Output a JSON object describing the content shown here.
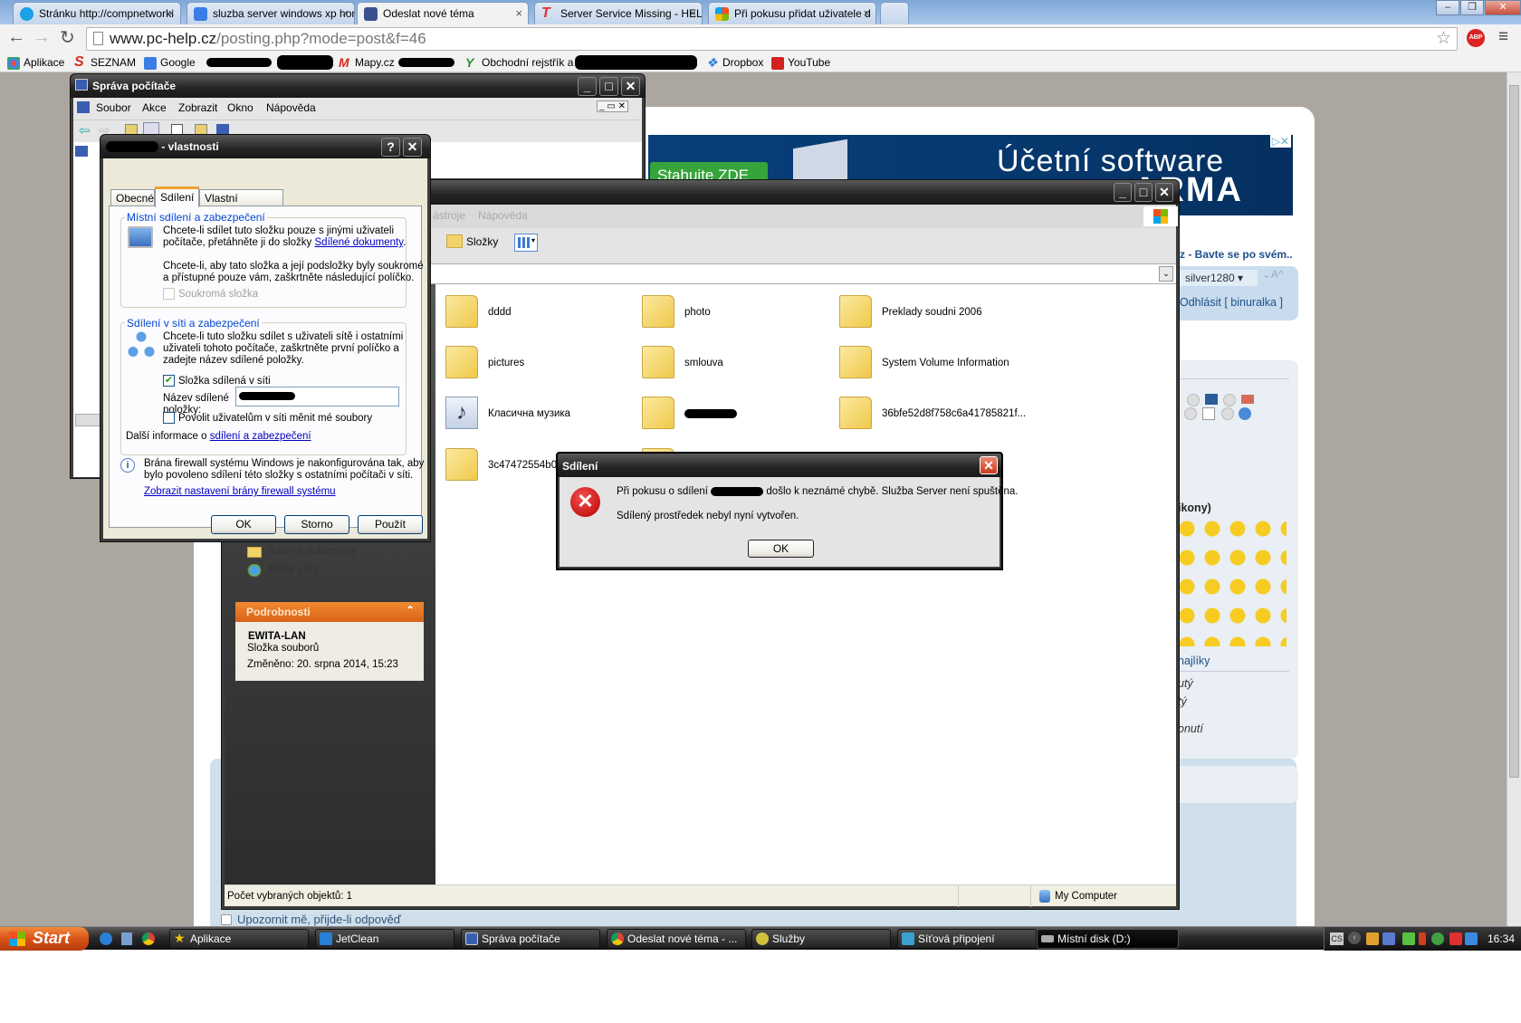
{
  "browser": {
    "tabs": [
      {
        "label": "Stránku http://compnetworki",
        "icon": "a-icon",
        "color": "#1aa1e6"
      },
      {
        "label": "sluzba server windows xp hor",
        "icon": "google-icon",
        "color": "#3b7de6"
      },
      {
        "label": "Odeslat nové téma",
        "icon": "computer-icon",
        "color": "#3a4f8f"
      },
      {
        "label": "Server Service Missing - HEL",
        "icon": "t-icon",
        "color": "#e03030"
      },
      {
        "label": "Při pokusu přidat uživatele d",
        "icon": "windows-icon",
        "color": "#f0a020"
      }
    ],
    "url_host": "www.pc-help.cz",
    "url_path": "/posting.php?mode=post&f=46",
    "bookmarks": [
      {
        "label": "Aplikace",
        "color": "#e84c3d"
      },
      {
        "label": "SEZNAM",
        "color": "#d52b1e"
      },
      {
        "label": "Google",
        "color": "#3b7de6"
      },
      {
        "label": "Mapy.cz",
        "color": "#d52b1e"
      },
      {
        "label": "Obchodní rejstřík a Sb...",
        "color": "#2e8b2e"
      },
      {
        "label": "Dropbox",
        "color": "#2b7fe0"
      },
      {
        "label": "YouTube",
        "color": "#d42020"
      }
    ],
    "abp": "ABP"
  },
  "webpage": {
    "ad_button": "Stahujte ZDE",
    "ad_line1": "Účetní software",
    "ad_line2": "ARMA",
    "tagline": "z - Bavte se po svém..",
    "style_select": "silver1280",
    "font_size_ctl": "⌄A^",
    "logout": "Odhlásit [ binuralka ]",
    "smilies_heading": "ikony)",
    "more_smilies": "najlíky",
    "opt1": "utý",
    "opt2": "tý",
    "opt3": "onutí",
    "notify": "Upozornit mě, přijde-li odpověď"
  },
  "compmgmt": {
    "title": "Správa počítače",
    "menu": [
      "Soubor",
      "Akce",
      "Zobrazit",
      "Okno",
      "Nápověda"
    ]
  },
  "properties": {
    "title_suffix": " - vlastnosti",
    "tabs": [
      "Obecné",
      "Sdílení",
      "Vlastní nastavení"
    ],
    "local_group": "Místní sdílení a zabezpečení",
    "local_text1a": "Chcete-li sdílet tuto složku pouze s jinými uživateli",
    "local_text1b": "počítače, přetáhněte ji do složky ",
    "local_link": "Sdílené dokumenty",
    "local_text2a": "Chcete-li, aby tato složka a její podsložky byly soukromé",
    "local_text2b": "a přístupné pouze vám, zaškrtněte následující políčko.",
    "private_label": "Soukromá složka",
    "network_group": "Sdílení v síti a zabezpečení",
    "net_text1": "Chcete-li tuto složku sdílet s uživateli sítě i ostatními",
    "net_text2": "uživateli tohoto počítače, zaškrtněte první políčko a",
    "net_text3": "zadejte název sdílené položky.",
    "share_label": "Složka sdílená v síti",
    "share_checked": true,
    "share_name_label1": "Název sdílené",
    "share_name_label2": "položky:",
    "allow_label": "Povolit uživatelům v síti měnit mé soubory",
    "more_info": "Další informace o ",
    "more_info_link": "sdílení a zabezpečení",
    "firewall1": "Brána firewall systému Windows je nakonfigurována tak, aby",
    "firewall2": "bylo povoleno sdílení této složky s ostatními počítači v síti.",
    "firewall_link": "Zobrazit nastavení brány firewall systému",
    "ok": "OK",
    "cancel": "Storno",
    "apply": "Použít"
  },
  "explorer": {
    "menu_partial": [
      "ástroje",
      "Nápověda"
    ],
    "folders_button": "Složky",
    "files": [
      {
        "name": "dddd",
        "type": "folder"
      },
      {
        "name": "photo",
        "type": "folder"
      },
      {
        "name": "Preklady soudni 2006",
        "type": "folder"
      },
      {
        "name": "pictures",
        "type": "folder"
      },
      {
        "name": "smlouva",
        "type": "folder"
      },
      {
        "name": "System Volume Information",
        "type": "folder"
      },
      {
        "name": "Класична музика",
        "type": "music"
      },
      {
        "name": "",
        "type": "folder"
      },
      {
        "name": "36bfe52d8f758c6a41785821f...",
        "type": "folder"
      },
      {
        "name": "3c47472554b09",
        "type": "folder"
      },
      {
        "name": "",
        "type": "folder"
      }
    ],
    "places": [
      "Sdílené dokumenty",
      "Místa v síti"
    ],
    "details_header": "Podrobnosti",
    "details_name": "EWITA-LAN",
    "details_type": "Složka souborů",
    "details_modified": "Změněno: 20. srpna 2014, 15:23",
    "status_left": "Počet vybraných objektů: 1",
    "status_right": "My Computer"
  },
  "error": {
    "title": "Sdílení",
    "line1a": "Při pokusu o sdílení ",
    "line1b": " došlo k neznámé chybě. Služba Server není spuštěna.",
    "line2": "Sdílený prostředek nebyl nyní vytvořen.",
    "ok": "OK"
  },
  "taskbar": {
    "start": "Start",
    "items": [
      {
        "label": "Aplikace",
        "color": "#f2c200"
      },
      {
        "label": "JetClean",
        "color": "#2a7fd6"
      },
      {
        "label": "Správa počítače",
        "color": "#3a5fb0"
      },
      {
        "label": "Odeslat nové téma - ...",
        "color": "#e8a020"
      },
      {
        "label": "Služby",
        "color": "#d0c040"
      },
      {
        "label": "Síťová připojení",
        "color": "#3aa0d0"
      },
      {
        "label": "Místní disk (D:)",
        "color": "#aaaaaa"
      }
    ],
    "lang": "CS",
    "clock": "16:34"
  }
}
